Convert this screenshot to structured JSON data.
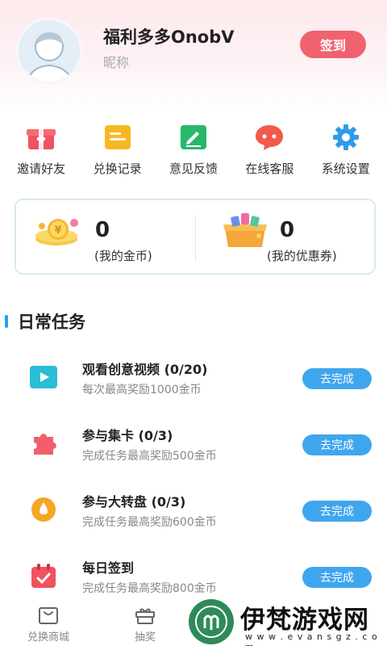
{
  "profile": {
    "username": "福利多多OnobV",
    "nickname": "昵称",
    "signin_label": "签到"
  },
  "quick_menu": [
    {
      "label": "邀请好友",
      "icon": "gift-box-icon",
      "color": "#f0525e"
    },
    {
      "label": "兑换记录",
      "icon": "record-card-icon",
      "color": "#f6b822"
    },
    {
      "label": "意见反馈",
      "icon": "edit-note-icon",
      "color": "#27b86b"
    },
    {
      "label": "在线客服",
      "icon": "chat-bubble-icon",
      "color": "#f25a4b"
    },
    {
      "label": "系统设置",
      "icon": "gear-icon",
      "color": "#2e9bea"
    }
  ],
  "wallet": {
    "coins_value": "0",
    "coins_label": "(我的金币)",
    "coupons_value": "0",
    "coupons_label": "(我的优惠券)"
  },
  "daily_tasks": {
    "title": "日常任务",
    "items": [
      {
        "title": "观看创意视频 (0/20)",
        "desc": "每次最高奖励1000金币",
        "button": "去完成",
        "icon": "video-play-icon"
      },
      {
        "title": "参与集卡 (0/3)",
        "desc": "完成任务最高奖励500金币",
        "button": "去完成",
        "icon": "puzzle-icon"
      },
      {
        "title": "参与大转盘 (0/3)",
        "desc": "完成任务最高奖励600金币",
        "button": "去完成",
        "icon": "wheel-coin-icon"
      },
      {
        "title": "每日签到",
        "desc": "完成任务最高奖励800金币",
        "button": "去完成",
        "icon": "calendar-icon"
      }
    ]
  },
  "bottom_nav": [
    {
      "label": "兑换商城",
      "icon": "mall-icon"
    },
    {
      "label": "抽奖",
      "icon": "gift-icon"
    }
  ],
  "watermark": {
    "text": "伊梵游戏网",
    "url": "w w w . e v a n s g z . c o m"
  },
  "colors": {
    "accent_red": "#f0626e",
    "accent_blue": "#3fa6ee",
    "header_pink": "#fde9ec"
  }
}
